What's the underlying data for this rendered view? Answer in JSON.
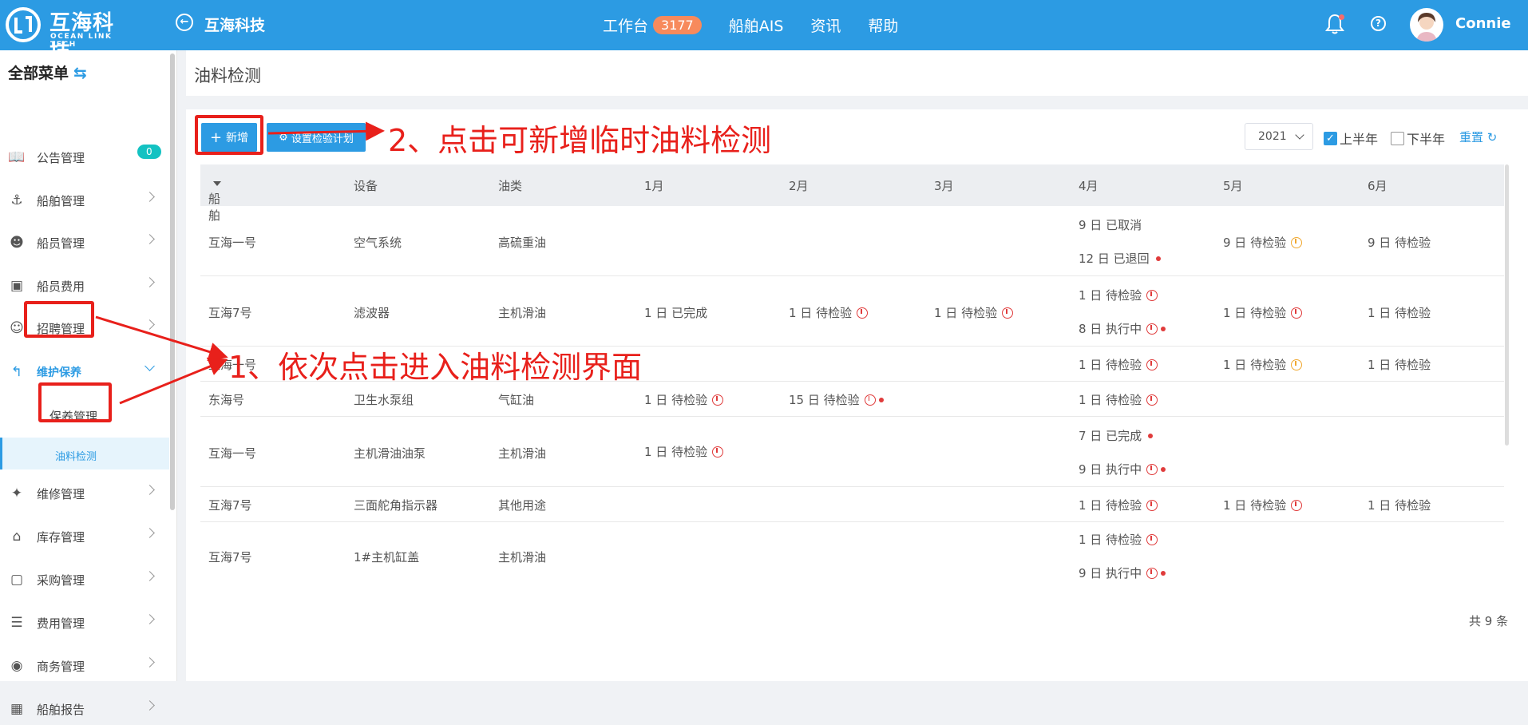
{
  "header": {
    "logo_cn": "互海科技",
    "logo_en": "OCEAN LINK TECH",
    "app_title": "互海科技",
    "nav": [
      {
        "label": "工作台",
        "badge": "3177"
      },
      {
        "label": "船舶AIS"
      },
      {
        "label": "资讯"
      },
      {
        "label": "帮助"
      }
    ],
    "user": "Connie"
  },
  "sidebar": {
    "title": "全部菜单",
    "items": [
      {
        "label": "公告管理",
        "icon": "book-icon",
        "badge": "0"
      },
      {
        "label": "船舶管理",
        "icon": "anchor-icon"
      },
      {
        "label": "船员管理",
        "icon": "user-icon"
      },
      {
        "label": "船员费用",
        "icon": "wallet-icon"
      },
      {
        "label": "招聘管理",
        "icon": "recruit-icon"
      },
      {
        "label": "维护保养",
        "icon": "wrench-icon",
        "expanded": true
      },
      {
        "label": "保养管理"
      },
      {
        "label": "油料检测",
        "selected": true
      },
      {
        "label": "维修管理",
        "icon": "repair-icon"
      },
      {
        "label": "库存管理",
        "icon": "warehouse-icon"
      },
      {
        "label": "采购管理",
        "icon": "cart-icon"
      },
      {
        "label": "费用管理",
        "icon": "coins-icon"
      },
      {
        "label": "商务管理",
        "icon": "globe-icon"
      },
      {
        "label": "船舶报告",
        "icon": "calendar-icon"
      }
    ]
  },
  "page": {
    "title": "油料检测",
    "add_label": "新增",
    "plan_label": "设置检验计划",
    "year": "2021",
    "first_half": "上半年",
    "second_half": "下半年",
    "reset": "重置",
    "total": "共 9 条"
  },
  "table": {
    "columns": [
      "船舶",
      "设备",
      "油类",
      "1月",
      "2月",
      "3月",
      "4月",
      "5月",
      "6月"
    ],
    "rows": [
      {
        "ship": "互海一号",
        "device": "空气系统",
        "oil": "高硫重油",
        "apr": [
          "9 日 已取消",
          "12 日 已退回"
        ],
        "may": "9 日 待检验",
        "jun": "9 日 待检验"
      },
      {
        "ship": "互海7号",
        "device": "滤波器",
        "oil": "主机滑油",
        "jan": "1 日 已完成",
        "feb": "1 日 待检验",
        "mar": "1 日 待检验",
        "apr": [
          "1 日 待检验",
          "8 日 执行中"
        ],
        "may": "1 日 待检验",
        "jun": "1 日 待检验"
      },
      {
        "ship": "互海一号",
        "device": "",
        "oil": "",
        "apr": [
          "1 日 待检验"
        ],
        "may": "1 日 待检验",
        "jun": "1 日 待检验"
      },
      {
        "ship": "东海号",
        "device": "卫生水泵组",
        "oil": "气缸油",
        "jan": "1 日 待检验",
        "feb": "15 日 待检验",
        "apr": [
          "1 日 待检验"
        ]
      },
      {
        "ship": "互海一号",
        "device": "主机滑油油泵",
        "oil": "主机滑油",
        "jan": "1 日 待检验",
        "apr": [
          "7 日 已完成",
          "9 日 执行中"
        ]
      },
      {
        "ship": "互海7号",
        "device": "三面舵角指示器",
        "oil": "其他用途",
        "apr": [
          "1 日 待检验"
        ],
        "may": "1 日 待检验",
        "jun": "1 日 待检验"
      },
      {
        "ship": "互海7号",
        "device": "1#主机缸盖",
        "oil": "主机滑油",
        "apr": [
          "1 日 待检验",
          "9 日 执行中"
        ]
      }
    ]
  },
  "annotations": {
    "step1": "1、依次点击进入油料检测界面",
    "step2": "2、点击可新增临时油料检测"
  },
  "colors": {
    "primary": "#2c9be3",
    "annotation": "#e8201b",
    "badge": "#f78a5c",
    "warn": "#f0a830",
    "alert": "#e03b3b"
  }
}
